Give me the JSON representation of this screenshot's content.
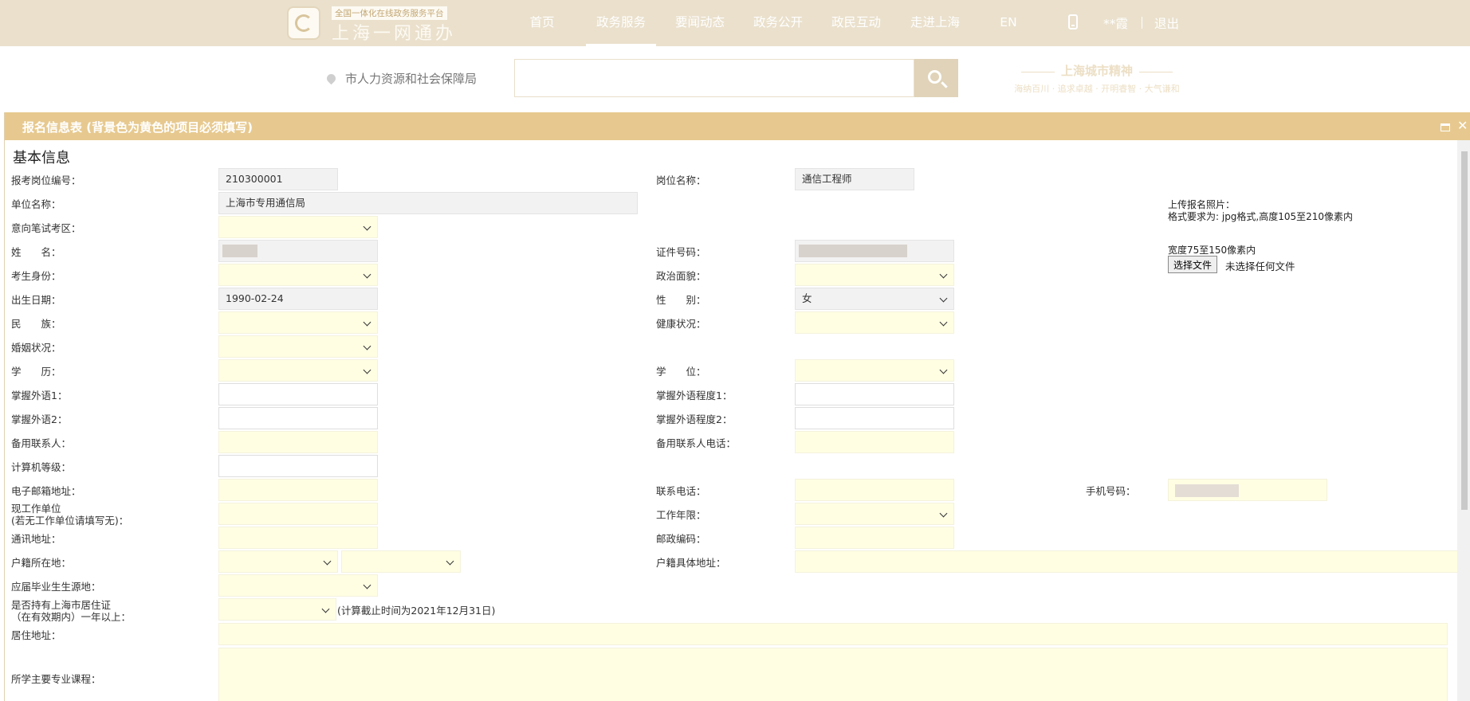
{
  "header": {
    "logo_tagline": "全国一体化在线政务服务平台",
    "logo_name": "上海一网通办",
    "nav": [
      "首页",
      "政务服务",
      "要闻动态",
      "政务公开",
      "政民互动",
      "走进上海",
      "EN"
    ],
    "active_nav": "政务服务",
    "username": "**霞",
    "logout": "退出"
  },
  "search": {
    "location": "市人力资源和社会保障局",
    "placeholder": ""
  },
  "spirit": {
    "title": "上海城市精神",
    "subtitle": "海纳百川 · 追求卓越 · 开明睿智 · 大气谦和"
  },
  "dialog": {
    "title": "报名信息表 (背景色为黄色的项目必须填写)",
    "section_title": "基本信息",
    "labels": {
      "job_code": "报考岗位编号：",
      "job_name": "岗位名称：",
      "unit_name": "单位名称：",
      "exam_area": "意向笔试考区：",
      "name": "姓　　名：",
      "id_number": "证件号码：",
      "identity": "考生身份：",
      "political": "政治面貌：",
      "birth_date": "出生日期：",
      "gender": "性　　别：",
      "ethnicity": "民　　族：",
      "health": "健康状况：",
      "marital": "婚姻状况：",
      "education": "学　　历：",
      "degree": "学　　位：",
      "lang1": "掌握外语1：",
      "lang1_level": "掌握外语程度1：",
      "lang2": "掌握外语2：",
      "lang2_level": "掌握外语程度2：",
      "backup_contact": "备用联系人：",
      "backup_phone": "备用联系人电话：",
      "computer_level": "计算机等级：",
      "email": "电子邮箱地址：",
      "contact_phone": "联系电话：",
      "mobile": "手机号码：",
      "employer_line1": "现工作单位",
      "employer_line2": "(若无工作单位请填写无)：",
      "work_years": "工作年限：",
      "mailing_address": "通讯地址：",
      "postal_code": "邮政编码：",
      "hukou": "户籍所在地：",
      "hukou_address": "户籍具体地址：",
      "graduate_origin": "应届毕业生生源地：",
      "residence_permit_line1": "是否持有上海市居住证",
      "residence_permit_line2": "（在有效期内）一年以上：",
      "residence_address": "居住地址：",
      "courses": "所学主要专业课程："
    },
    "values": {
      "job_code": "210300001",
      "job_name": "通信工程师",
      "unit_name": "上海市专用通信局",
      "birth_date": "1990-02-24",
      "gender": "女"
    },
    "upload": {
      "label": "上传报名照片：",
      "format": "格式要求为: jpg格式,高度105至210像素内",
      "width": "宽度75至150像素内",
      "button": "选择文件",
      "no_file": "未选择任何文件"
    },
    "deadline_note": "(计算截止时间为2021年12月31日)"
  }
}
